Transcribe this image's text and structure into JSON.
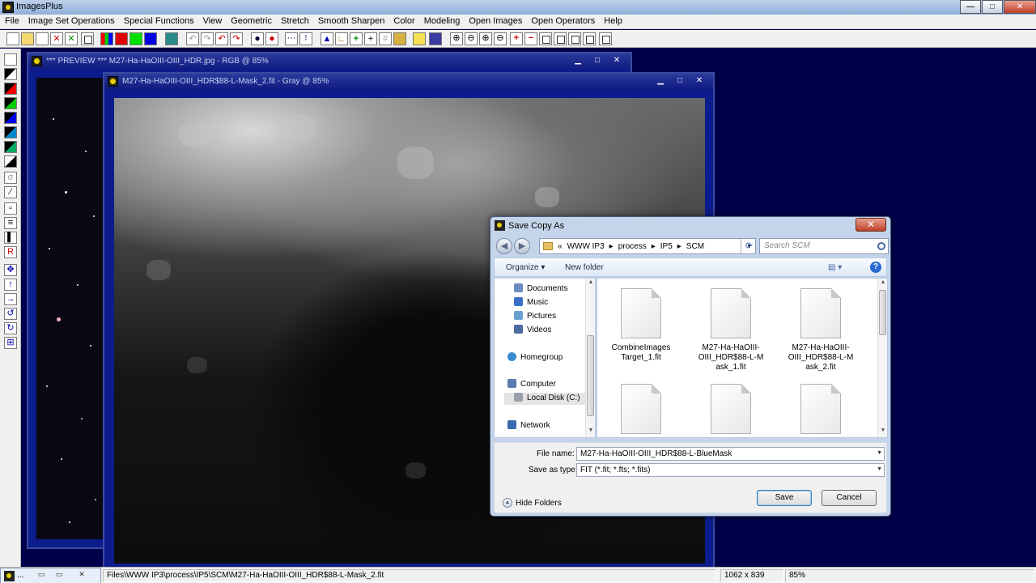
{
  "app": {
    "title": "ImagesPlus"
  },
  "menu": [
    "File",
    "Image Set Operations",
    "Special Functions",
    "View",
    "Geometric",
    "Stretch",
    "Smooth Sharpen",
    "Color",
    "Modeling",
    "Open Images",
    "Open Operators",
    "Help"
  ],
  "preview_window": {
    "title": "*** PREVIEW *** M27-Ha-HaOIII-OIII_HDR.jpg - RGB @ 85%"
  },
  "mask_window": {
    "title": "M27-Ha-HaOIII-OIII_HDR$88-L-Mask_2.fit - Gray @ 85%"
  },
  "dialog": {
    "title": "Save Copy As",
    "path": {
      "prefix": "«",
      "parts": [
        "WWW IP3",
        "process",
        "IP5",
        "SCM"
      ],
      "sep": "▸"
    },
    "search_placeholder": "Search SCM",
    "organize": "Organize ▾",
    "new_folder": "New folder",
    "help": "?",
    "nav_items": [
      {
        "label": "Documents",
        "color": "#6a8cc0"
      },
      {
        "label": "Music",
        "color": "#3a70c8"
      },
      {
        "label": "Pictures",
        "color": "#6aa0d0"
      },
      {
        "label": "Videos",
        "color": "#4a6aa0"
      },
      {
        "label": "Homegroup",
        "color": "#3a8ad0"
      },
      {
        "label": "Computer",
        "color": "#5a7ab0"
      },
      {
        "label": "Local Disk (C:)",
        "color": "#9aa0aa"
      },
      {
        "label": "Network",
        "color": "#3a6ab0"
      }
    ],
    "files": [
      {
        "name": "CombineImages Target_1.fit"
      },
      {
        "name": "M27-Ha-HaOIII-OIII_HDR$88-L-M ask_1.fit"
      },
      {
        "name": "M27-Ha-HaOIII-OIII_HDR$88-L-M ask_2.fit"
      },
      {
        "name": ""
      },
      {
        "name": ""
      },
      {
        "name": ""
      }
    ],
    "file_name_label": "File name:",
    "file_name": "M27-Ha-HaOIII-OIII_HDR$88-L-BlueMask",
    "save_type_label": "Save as type:",
    "save_type": "FIT (*.fit; *.fts; *.fits)",
    "hide_folders": "Hide Folders",
    "save": "Save",
    "cancel": "Cancel"
  },
  "status": {
    "path": "Files\\WWW IP3\\process\\IP5\\SCM\\M27-Ha-HaOIII-OIII_HDR$88-L-Mask_2.fit",
    "dims": "1062 x 839",
    "zoom": "85%"
  }
}
